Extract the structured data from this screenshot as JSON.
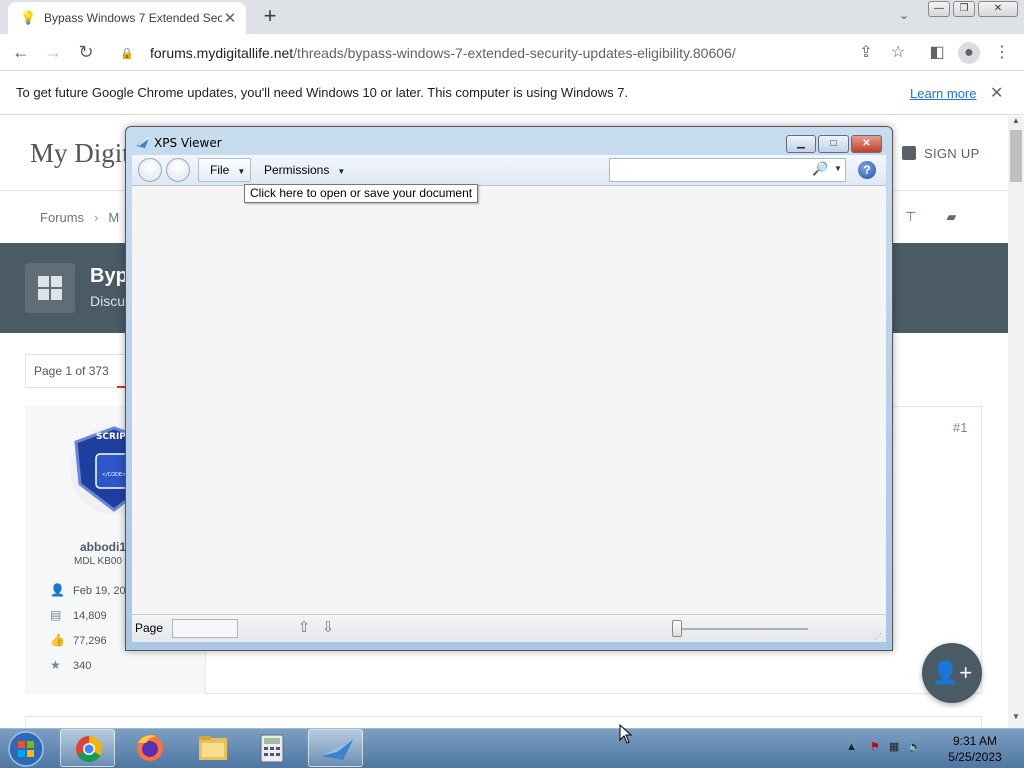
{
  "browser": {
    "tab_title": "Bypass Windows 7 Extended Sec",
    "url_host": "forums.mydigitallife.net",
    "url_path": "/threads/bypass-windows-7-extended-security-updates-eligibility.80606/",
    "infobar_text": "To get future Google Chrome updates, you'll need Windows 10 or later. This computer is using Windows 7.",
    "learn_more": "Learn more"
  },
  "site": {
    "logo_text": "My Digita",
    "signup": "SIGN UP",
    "breadcrumb_forums": "Forums",
    "breadcrumb_next": "M",
    "banner_title": "Byp",
    "banner_sub": "Discu",
    "page_selector": "Page 1 of 373",
    "post_number": "#1",
    "user": {
      "name": "abbodi1",
      "title": "MDL KB00",
      "joined": "Feb 19, 20",
      "messages": "14,809",
      "likes": "77,296",
      "points": "340"
    }
  },
  "xps": {
    "title": "XPS Viewer",
    "file_menu": "File",
    "permissions_menu": "Permissions",
    "tooltip": "Click here to open or save your document",
    "search_placeholder": "",
    "page_label": "Page",
    "page_value": "",
    "help": "?"
  },
  "taskbar": {
    "time": "9:31 AM",
    "date": "5/25/2023"
  },
  "icons": {
    "tab_favicon": "lightbulb-icon",
    "lock": "lock-icon",
    "share": "share-icon",
    "star": "star-icon",
    "sidepanel": "side-panel-icon",
    "profile": "profile-icon",
    "menu": "kebab-menu-icon"
  }
}
